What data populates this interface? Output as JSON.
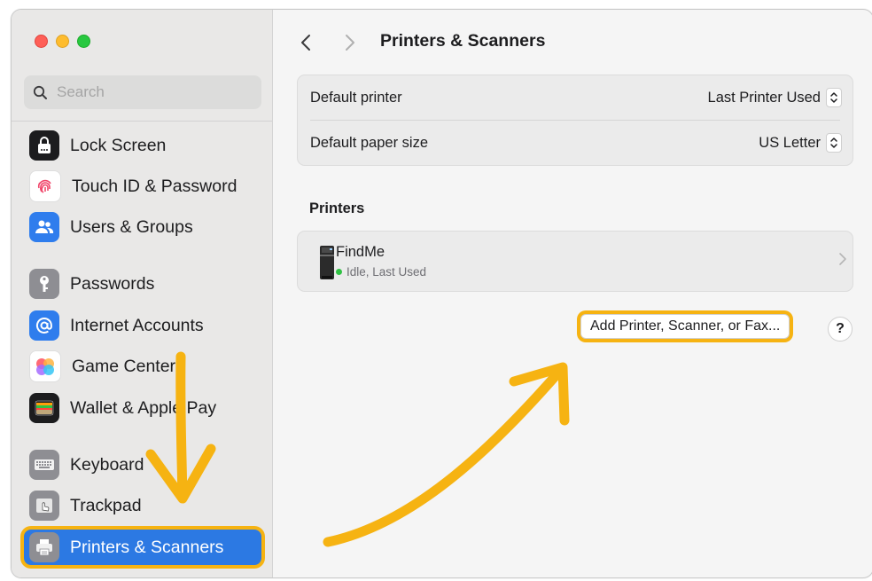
{
  "window": {
    "title": "Printers & Scanners"
  },
  "search": {
    "placeholder": "Search"
  },
  "sidebar": {
    "items": [
      {
        "label": "Lock Screen",
        "icon": "lock-icon"
      },
      {
        "label": "Touch ID & Password",
        "icon": "fingerprint-icon"
      },
      {
        "label": "Users & Groups",
        "icon": "users-icon"
      },
      {
        "label": "Passwords",
        "icon": "key-icon"
      },
      {
        "label": "Internet Accounts",
        "icon": "at-icon"
      },
      {
        "label": "Game Center",
        "icon": "game-center-icon"
      },
      {
        "label": "Wallet & Apple Pay",
        "icon": "wallet-icon"
      },
      {
        "label": "Keyboard",
        "icon": "keyboard-icon"
      },
      {
        "label": "Trackpad",
        "icon": "trackpad-icon"
      },
      {
        "label": "Printers & Scanners",
        "icon": "printer-icon",
        "selected": true
      }
    ]
  },
  "settings": {
    "default_printer_label": "Default printer",
    "default_printer_value": "Last Printer Used",
    "paper_size_label": "Default paper size",
    "paper_size_value": "US Letter"
  },
  "printers": {
    "section_title": "Printers",
    "items": [
      {
        "name": "FindMe",
        "status": "Idle, Last Used",
        "status_color": "#30c244"
      }
    ]
  },
  "actions": {
    "add_label": "Add Printer, Scanner, or Fax...",
    "help_label": "?"
  },
  "colors": {
    "accent": "#2c79e3",
    "highlight": "#f6b312"
  }
}
